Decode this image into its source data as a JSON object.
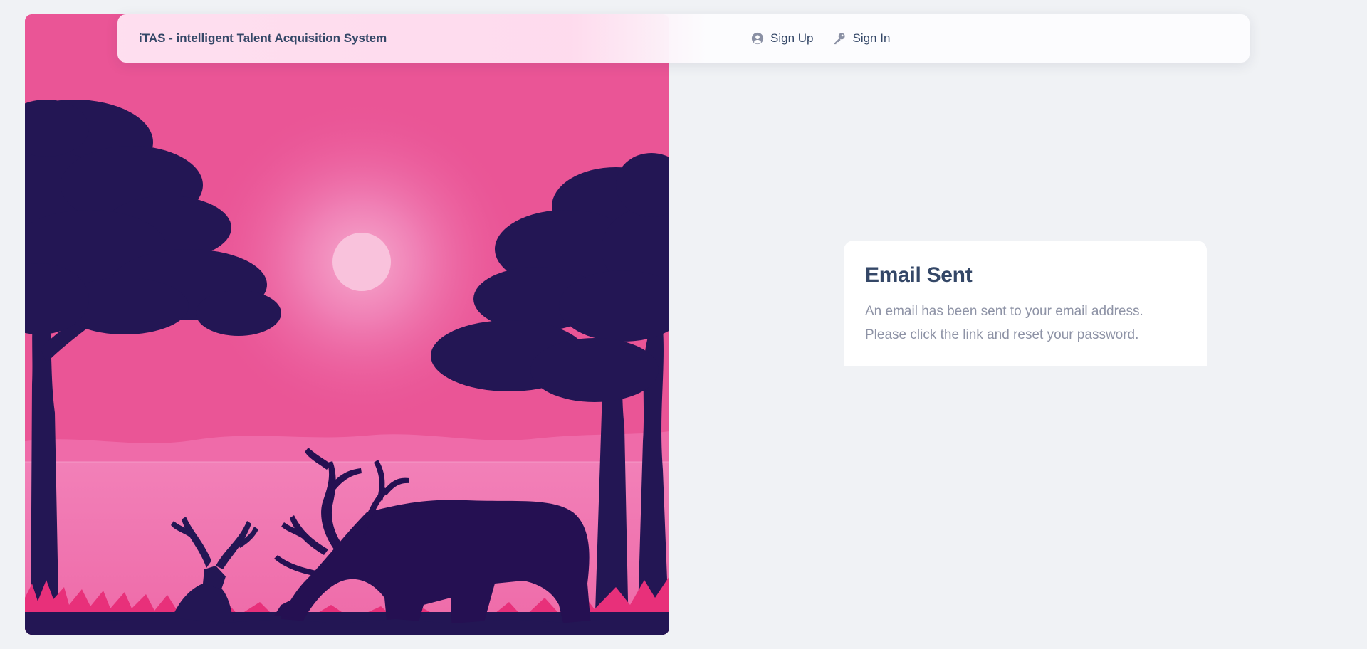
{
  "navbar": {
    "brand": "iTAS - intelligent Talent Acquisition System",
    "links": [
      {
        "label": "Sign Up",
        "icon": "user-circle-icon"
      },
      {
        "label": "Sign In",
        "icon": "key-icon"
      }
    ]
  },
  "hero": {
    "image": "deer-sunset-illustration",
    "colors": {
      "sky": "#ea5596",
      "sun": "#f9c2dc",
      "lake": "#f07ab4",
      "silhouette": "#231654",
      "grass": "#e8307a"
    }
  },
  "card": {
    "title": "Email Sent",
    "line1": "An email has been sent to your email address.",
    "line2": "Please click the link and reset your password."
  },
  "colors": {
    "background": "#f0f2f5",
    "text_dark": "#344767",
    "text_muted": "#8e93a6"
  }
}
